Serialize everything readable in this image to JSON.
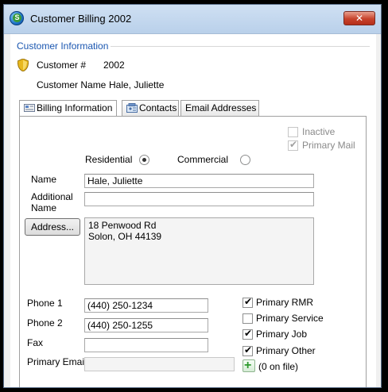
{
  "window": {
    "title": "Customer Billing 2002",
    "close_glyph": "✕",
    "app_icon": "app-logo-icon",
    "app_icon_letter": "S"
  },
  "customer_info": {
    "group_label": "Customer Information",
    "customer_num_label": "Customer #",
    "customer_num_value": "2002",
    "customer_name_label": "Customer Name",
    "customer_name_value": "Hale, Juliette",
    "icon": "shield-icon"
  },
  "tabs": [
    {
      "label": "Billing Information",
      "icon": "billing-icon",
      "active": true
    },
    {
      "label": "Contacts",
      "icon": "contacts-icon",
      "active": false
    },
    {
      "label": "Email Addresses",
      "icon": "",
      "active": false
    }
  ],
  "billing": {
    "inactive_label": "Inactive",
    "inactive_checked": false,
    "primary_mail_label": "Primary Mail",
    "primary_mail_checked": true,
    "residential_label": "Residential",
    "residential_selected": true,
    "commercial_label": "Commercial",
    "commercial_selected": false,
    "name_label": "Name",
    "name_value": "Hale, Juliette",
    "additional_name_label_1": "Additional",
    "additional_name_label_2": "Name",
    "additional_name_value": "",
    "address_button": "Address...",
    "address_line1": "18 Penwood Rd",
    "address_line2": "Solon, OH  44139",
    "phone1_label": "Phone 1",
    "phone1_value": "(440) 250-1234",
    "phone2_label": "Phone 2",
    "phone2_value": "(440) 250-1255",
    "fax_label": "Fax",
    "fax_value": "",
    "primary_email_label": "Primary Email",
    "primary_email_value": "",
    "primary_rmr_label": "Primary RMR",
    "primary_rmr_checked": true,
    "primary_service_label": "Primary Service",
    "primary_service_checked": false,
    "primary_job_label": "Primary Job",
    "primary_job_checked": true,
    "primary_other_label": "Primary Other",
    "primary_other_checked": true,
    "on_file_label": "(0 on file)"
  },
  "colors": {
    "group_label": "#1a56b0",
    "close_button": "#c7432c",
    "title_bar": "#b9d0ea"
  }
}
